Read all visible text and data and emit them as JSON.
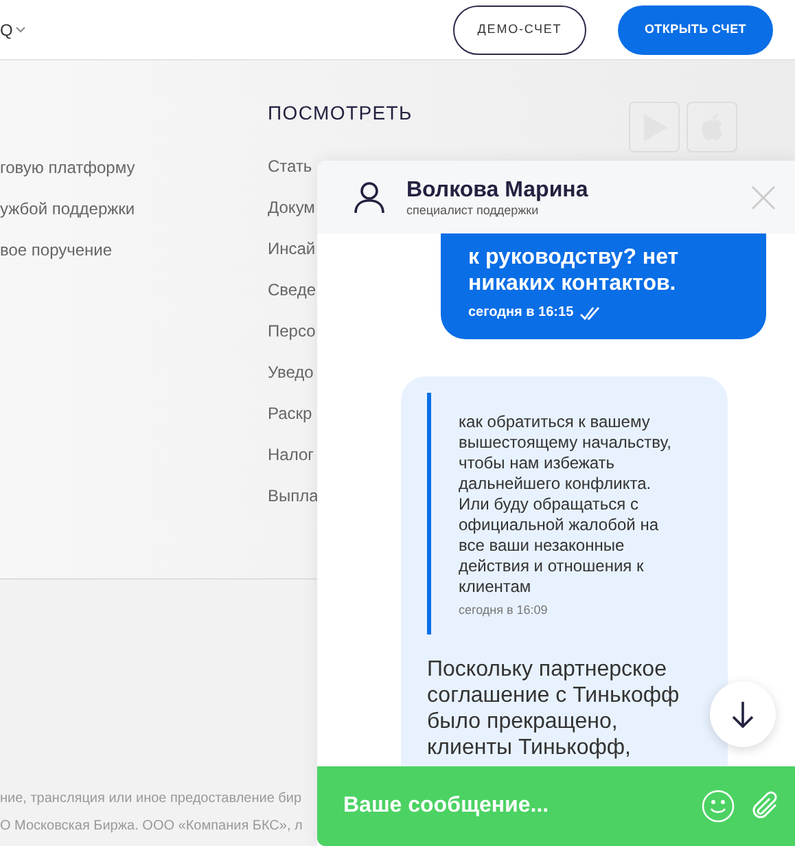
{
  "header": {
    "menu_label": "Q",
    "buttons": [
      {
        "label": "ДЕМО-СЧЕТ",
        "kind": "outline"
      },
      {
        "label": "ОТКРЫТЬ СЧЕТ",
        "kind": "primary"
      }
    ]
  },
  "left_links": [
    "говую платформу",
    "ужбой поддержки",
    "вое поручение"
  ],
  "view_section": {
    "title": "ПОСМОТРЕТЬ",
    "links": [
      "Стать",
      "Докум",
      "Инсай",
      "Сведе",
      "Персо",
      "Уведо",
      "Раскр",
      "Налог",
      "Выпла"
    ]
  },
  "footer": [
    "ние, трансляция или иное предоставление бир",
    "О Московская Биржа. ООО «Компания БКС», л"
  ],
  "chat": {
    "agent_name": "Волкова Марина",
    "agent_role": "специалист поддержки",
    "messages": [
      {
        "kind": "outgoing",
        "text": "к руководству? нет никаких контактов.",
        "time": "сегодня в 16:15",
        "read": true
      },
      {
        "kind": "incoming",
        "quote": "как обратиться к вашему вышестоящему начальству, чтобы нам избежать дальнейшего конфликта. Или буду обращаться с официальной жалобой на все ваши незаконные действия и отношения к клиентам",
        "quote_time": "сегодня в 16:09",
        "text": "Поскольку партнерское соглашение с Тинькофф было прекращено, клиенты Тинькофф,"
      }
    ],
    "input": {
      "placeholder": "Ваше сообщение..."
    }
  }
}
